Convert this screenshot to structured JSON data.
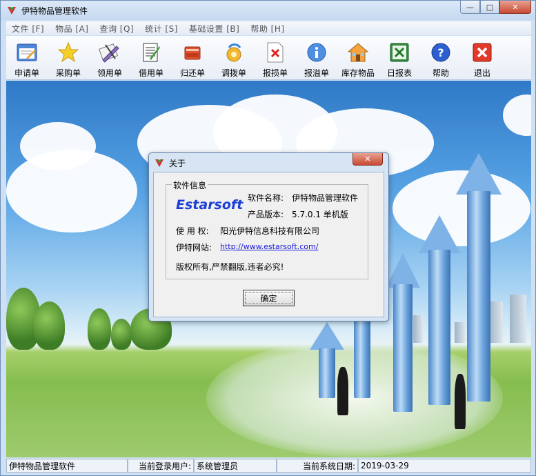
{
  "window": {
    "title": "伊特物品管理软件",
    "controls": {
      "minimize": "—",
      "maximize": "□",
      "close": "✕"
    }
  },
  "menu": [
    {
      "label": "文件 [F]"
    },
    {
      "label": "物品 [A]"
    },
    {
      "label": "查询 [Q]"
    },
    {
      "label": "统计 [S]"
    },
    {
      "label": "基础设置 [B]"
    },
    {
      "label": "帮助 [H]"
    }
  ],
  "toolbar": [
    {
      "label": "申请单",
      "icon": "request-form-icon"
    },
    {
      "label": "采购单",
      "icon": "star-icon"
    },
    {
      "label": "领用单",
      "icon": "pen-tools-icon"
    },
    {
      "label": "借用单",
      "icon": "notebook-icon"
    },
    {
      "label": "归还单",
      "icon": "book-return-icon"
    },
    {
      "label": "调拨单",
      "icon": "transfer-icon"
    },
    {
      "label": "报损单",
      "icon": "damage-document-icon"
    },
    {
      "label": "报溢单",
      "icon": "info-icon"
    },
    {
      "label": "库存物品",
      "icon": "house-icon"
    },
    {
      "label": "日报表",
      "icon": "excel-icon"
    },
    {
      "label": "帮助",
      "icon": "help-icon"
    },
    {
      "label": "退出",
      "icon": "exit-icon"
    }
  ],
  "dialog": {
    "title": "关于",
    "close": "✕",
    "group_title": "软件信息",
    "brand": "Estarsoft",
    "name_label": "软件名称:",
    "name_value": "伊特物品管理软件",
    "version_label": "产品版本:",
    "version_value": "5.7.0.1 单机版",
    "license_label": "使 用 权:",
    "license_value": "阳光伊特信息科技有限公司",
    "website_label": "伊特网站:",
    "website_url": "http://www.estarsoft.com/",
    "copyright": "版权所有,严禁翻版,违者必究!",
    "ok_button": "确定"
  },
  "statusbar": {
    "app_name": "伊特物品管理软件",
    "user_label": "当前登录用户:",
    "user_value": "系统管理员",
    "date_label": "当前系统日期:",
    "date_value": "2019-03-29"
  }
}
